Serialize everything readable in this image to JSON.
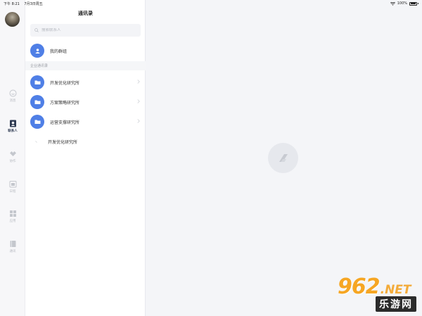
{
  "status_bar": {
    "time": "下午 8:21",
    "date": "7月3日周五",
    "battery": "100%"
  },
  "rail": {
    "items": [
      {
        "label": "消息",
        "icon": "chat-icon",
        "active": false
      },
      {
        "label": "联系人",
        "icon": "contacts-icon",
        "active": true
      },
      {
        "label": "协作",
        "icon": "collaboration-icon",
        "active": false
      },
      {
        "label": "日程",
        "icon": "calendar-icon",
        "active": false
      },
      {
        "label": "应用",
        "icon": "apps-icon",
        "active": false
      },
      {
        "label": "通讯",
        "icon": "book-icon",
        "active": false
      }
    ]
  },
  "contacts_panel": {
    "title": "通讯录",
    "search_placeholder": "搜索联系人",
    "my_groups_label": "我的群组",
    "section_label": "企业通讯录",
    "departments": [
      {
        "name": "开发优化研究所"
      },
      {
        "name": "方案策略研究所"
      },
      {
        "name": "运营支撑研究所"
      }
    ],
    "sub_item": "开发优化研究所"
  },
  "watermark": {
    "number": "962",
    "domain": ".NET",
    "cn": "乐游网"
  },
  "colors": {
    "accent": "#4f7fe6",
    "background": "#f4f5f8",
    "watermark_orange": "#f6a623"
  }
}
